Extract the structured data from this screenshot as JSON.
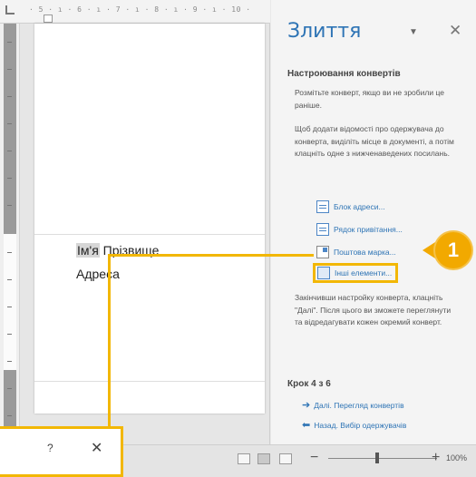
{
  "ruler": {
    "marks": "· 5 · ı · 6 · ı · 7 · ı · 8 · ı · 9 · ı · 10 ·"
  },
  "document": {
    "first_name": "Ім'я",
    "last_name": "Прізвище",
    "address": "Адреса"
  },
  "pane": {
    "title": "Злиття",
    "menu_icon": "▼",
    "close_icon": "✕",
    "section_heading": "Настроювання конвертів",
    "text1": "Розмітьте конверт, якщо ви не зробили це раніше.",
    "text2": "Щоб додати відомості про одержувача до конверта, виділіть місце в документі, а потім клацніть одне з нижченаведених посилань.",
    "links": {
      "address_block": "Блок адреси...",
      "greeting_line": "Рядок привітання...",
      "postage": "Поштова марка...",
      "more_items": "Інші елементи..."
    },
    "text3": "Закінчивши настройку конверта, клацніть \"Далі\". Після цього ви зможете переглянути та відредагувати кожен окремий конверт.",
    "step": "Крок 4 з 6",
    "next": "Далі. Перегляд конвертів",
    "back": "Назад. Вибір одержувачів",
    "arrow_next": "➔",
    "arrow_back": "⬅"
  },
  "callout": {
    "number": "1"
  },
  "dialog": {
    "help": "?",
    "close": "✕"
  },
  "status_bar": {
    "zoom_minus": "−",
    "zoom_plus": "+",
    "zoom": "100%"
  },
  "colors": {
    "accent": "#2e74b5",
    "callout": "#f2a900"
  }
}
